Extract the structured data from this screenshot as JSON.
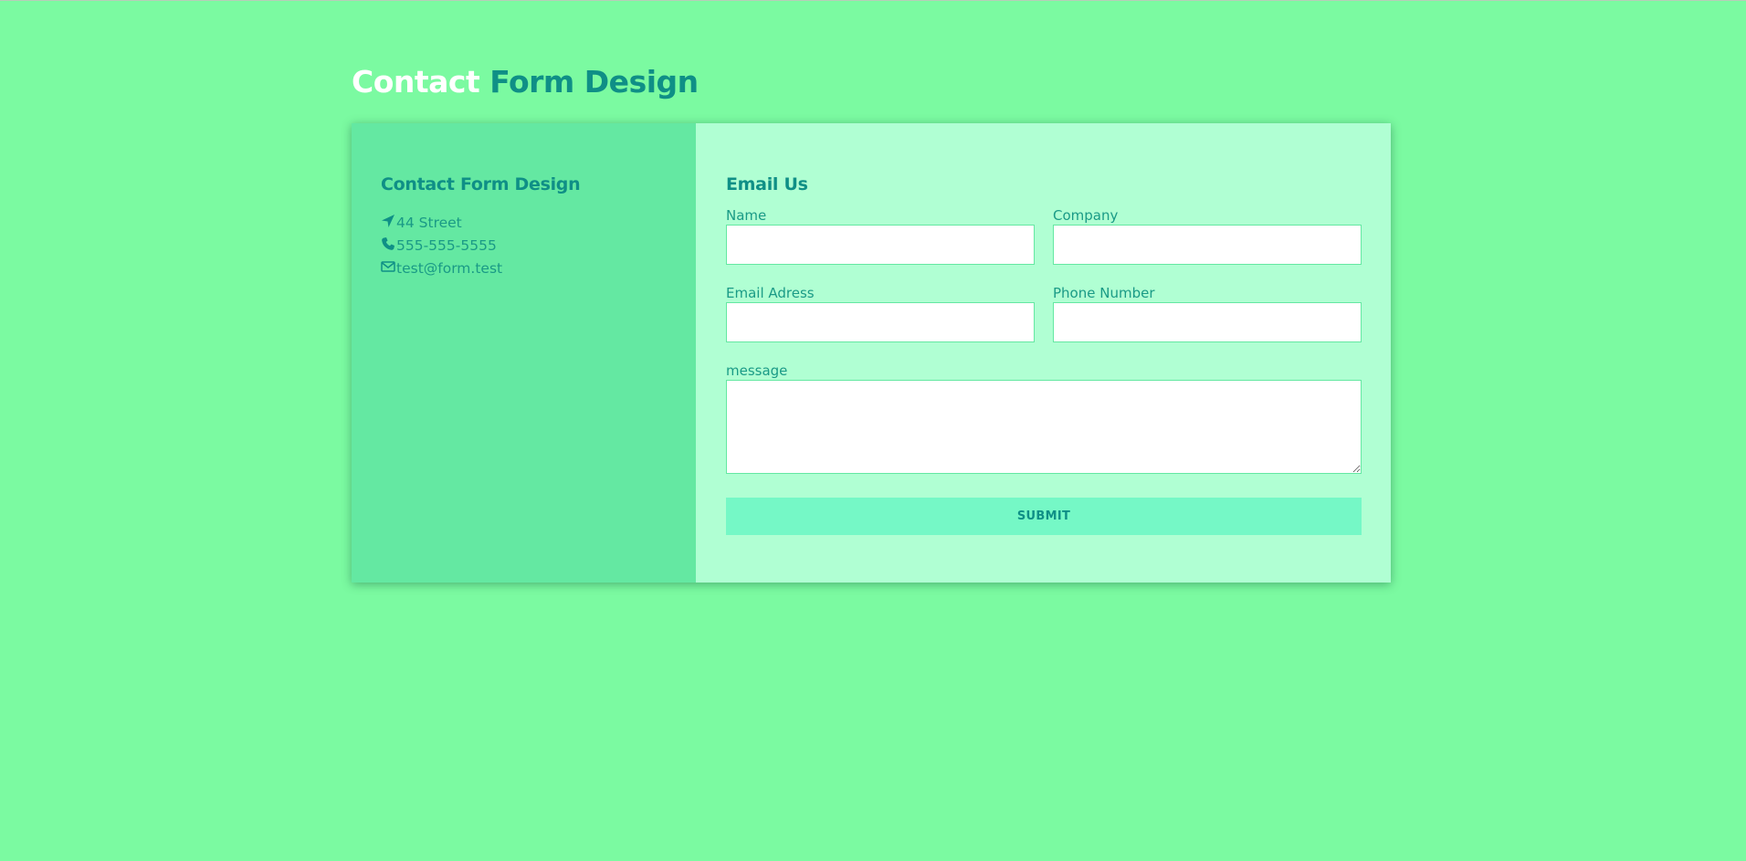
{
  "page": {
    "heading_part1": "Contact",
    "heading_part2": "Form Design"
  },
  "info": {
    "title": "Contact Form Design",
    "items": [
      {
        "icon": "location-arrow-icon",
        "text": "44 Street"
      },
      {
        "icon": "phone-icon",
        "text": "555-555-5555"
      },
      {
        "icon": "envelope-icon",
        "text": "test@form.test"
      }
    ]
  },
  "form": {
    "title": "Email Us",
    "name_label": "Name",
    "name_value": "",
    "company_label": "Company",
    "company_value": "",
    "email_label": "Email Adress",
    "email_value": "",
    "phone_label": "Phone Number",
    "phone_value": "",
    "message_label": "message",
    "message_value": "",
    "submit_label": "SUBMIT"
  },
  "colors": {
    "background": "#7bfaa1",
    "info_panel": "#64e8a2",
    "form_panel": "#b0ffd3",
    "accent_text": "#0f8f86",
    "submit_button": "#75f8c6"
  }
}
